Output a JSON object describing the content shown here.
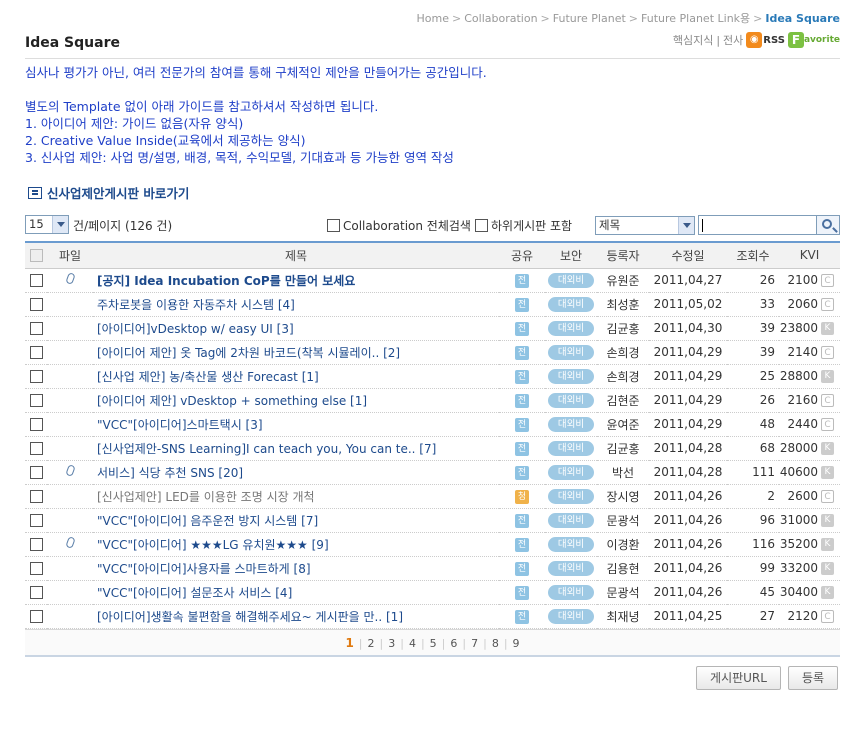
{
  "breadcrumb": [
    "Home",
    "Collaboration",
    "Future Planet",
    "Future Planet Link용",
    "Idea Square"
  ],
  "page_title": "Idea Square",
  "toplinks": {
    "link1": "핵심지식",
    "sep": "|",
    "link2": "전사",
    "rss": "RSS",
    "favorite": "avorite",
    "fav_icon": "F"
  },
  "description": [
    "심사나 평가가 아닌, 여러 전문가의 참여를 통해 구체적인 제안을 만들어가는 공간입니다.",
    "",
    "별도의 Template 없이 아래 가이드를 참고하셔서 작성하면 됩니다.",
    "1. 아이디어 제안: 가이드 없음(자유 양식)",
    "2. Creative Value Inside(교육에서 제공하는 양식)",
    "3. 신사업 제안: 사업 명/설명, 배경, 목적, 수익모델, 기대효과 등 가능한 영역 작성"
  ],
  "shortcut_label": "신사업제안게시판 바로가기",
  "toolbar": {
    "per_page_value": "15",
    "per_page_label": "건/페이지 (126 건)",
    "collab_search_label": "Collaboration 전체검색",
    "sub_board_label": "하위게시판 포함",
    "search_field_value": "제목",
    "search_query": ""
  },
  "columns": {
    "file": "파일",
    "title": "제목",
    "share": "공유",
    "security": "보안",
    "author": "등록자",
    "date": "수정일",
    "views": "조회수",
    "kvi": "KVI"
  },
  "rows": [
    {
      "file": true,
      "title": "[공지] Idea Incubation CoP를 만들어 보세요",
      "notice": true,
      "share": "전",
      "security": "대외비",
      "author": "유원준",
      "date": "2011,04,27",
      "views": "26",
      "kvi": "2100",
      "badge": "C"
    },
    {
      "file": false,
      "title": "주차로봇을 이용한 자동주차 시스템 [4]",
      "share": "전",
      "security": "대외비",
      "author": "최성훈",
      "date": "2011,05,02",
      "views": "33",
      "kvi": "2060",
      "badge": "C"
    },
    {
      "file": false,
      "title": "[아이디어]vDesktop w/ easy UI [3]",
      "share": "전",
      "security": "대외비",
      "author": "김균홍",
      "date": "2011,04,30",
      "views": "39",
      "kvi": "23800",
      "badge": "K"
    },
    {
      "file": false,
      "title": "[아이디어 제안] 옷 Tag에 2차원 바코드(착복 시뮬레이.. [2]",
      "share": "전",
      "security": "대외비",
      "author": "손희경",
      "date": "2011,04,29",
      "views": "39",
      "kvi": "2140",
      "badge": "C"
    },
    {
      "file": false,
      "title": "[신사업 제안] 농/축산물 생산 Forecast [1]",
      "share": "전",
      "security": "대외비",
      "author": "손희경",
      "date": "2011,04,29",
      "views": "25",
      "kvi": "28800",
      "badge": "K"
    },
    {
      "file": false,
      "title": "[아이디어 제안] vDesktop + something else [1]",
      "share": "전",
      "security": "대외비",
      "author": "김현준",
      "date": "2011,04,29",
      "views": "26",
      "kvi": "2160",
      "badge": "C"
    },
    {
      "file": false,
      "title": "\"VCC\"[아이디어]스마트택시 [3]",
      "share": "전",
      "security": "대외비",
      "author": "윤여준",
      "date": "2011,04,29",
      "views": "48",
      "kvi": "2440",
      "badge": "C"
    },
    {
      "file": false,
      "title": "[신사업제안-SNS Learning]I can teach you, You can te.. [7]",
      "share": "전",
      "security": "대외비",
      "author": "김균홍",
      "date": "2011,04,28",
      "views": "68",
      "kvi": "28000",
      "badge": "K"
    },
    {
      "file": true,
      "title": "서비스] 식당 추천 SNS [20]",
      "share": "전",
      "security": "대외비",
      "author": "박선",
      "date": "2011,04,28",
      "views": "111",
      "kvi": "40600",
      "badge": "K"
    },
    {
      "file": false,
      "title": "[신사업제안] LED를 이용한 조명 시장 개척",
      "gray": true,
      "share": "청",
      "share_orange": true,
      "security": "대외비",
      "author": "장시영",
      "date": "2011,04,26",
      "views": "2",
      "kvi": "2600",
      "badge": "C"
    },
    {
      "file": false,
      "title": "\"VCC\"[아이디어] 음주운전 방지 시스템 [7]",
      "share": "전",
      "security": "대외비",
      "author": "문광석",
      "date": "2011,04,26",
      "views": "96",
      "kvi": "31000",
      "badge": "K"
    },
    {
      "file": true,
      "title": "\"VCC\"[아이디어] ★★★LG 유치원★★★ [9]",
      "share": "전",
      "security": "대외비",
      "author": "이경환",
      "date": "2011,04,26",
      "views": "116",
      "kvi": "35200",
      "badge": "K"
    },
    {
      "file": false,
      "title": "\"VCC\"[아이디어]사용자를 스마트하게 [8]",
      "share": "전",
      "security": "대외비",
      "author": "김용현",
      "date": "2011,04,26",
      "views": "99",
      "kvi": "33200",
      "badge": "K"
    },
    {
      "file": false,
      "title": "\"VCC\"[아이디어] 설문조사 서비스 [4]",
      "share": "전",
      "security": "대외비",
      "author": "문광석",
      "date": "2011,04,26",
      "views": "45",
      "kvi": "30400",
      "badge": "K"
    },
    {
      "file": false,
      "title": "[아이디어]생활속 불편함을 해결해주세요~ 게시판을 만.. [1]",
      "share": "전",
      "security": "대외비",
      "author": "최재녕",
      "date": "2011,04,25",
      "views": "27",
      "kvi": "2120",
      "badge": "C"
    }
  ],
  "pagination": {
    "current": "1",
    "pages": [
      "1",
      "2",
      "3",
      "4",
      "5",
      "6",
      "7",
      "8",
      "9"
    ]
  },
  "buttons": {
    "board_url": "게시판URL",
    "register": "등록"
  },
  "colors": {
    "link": "#1d4a8c",
    "desc": "#1f3fc8",
    "accent": "#2a7ab8",
    "current_page": "#e07a10"
  }
}
